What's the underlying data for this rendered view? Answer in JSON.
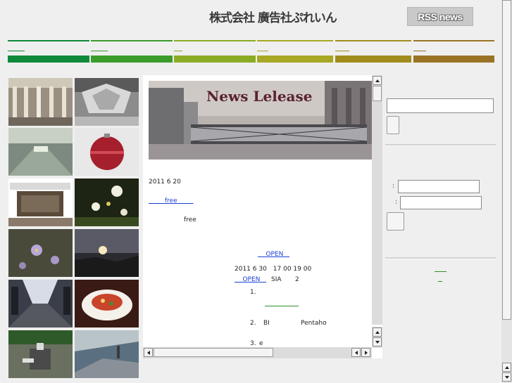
{
  "header": {
    "logo_text": "株式会社 廣告社ぷれいん",
    "rss_label": "RSS news"
  },
  "nav": {
    "colors": [
      "#0f8a3a",
      "#3a9c2a",
      "#8cab25",
      "#a8a824",
      "#a08c1c",
      "#9a7425"
    ]
  },
  "gallery": {
    "photos": [
      "hall-columns-photo",
      "chandelier-photo",
      "corridor-photo",
      "red-ornament-photo",
      "signboard-photo",
      "white-flowers-photo",
      "purple-flowers-photo",
      "sunset-photo",
      "train-corridor-photo",
      "pasta-dish-photo",
      "rooftop-photo",
      "harbor-view-photo"
    ]
  },
  "news": {
    "banner_title": "News Lelease",
    "date": "2011 6 20",
    "link_free": "free",
    "text_free": "free",
    "link_open": "OPEN",
    "datetime": "2011 6 30　17 00 19 00",
    "open2": "OPEN",
    "sia": "SIA",
    "sia_num": "2",
    "item1": "1.",
    "item2": "2.",
    "item2_bi": "BI",
    "item2_pentaho": "Pentaho",
    "item3": "3.",
    "item3_e": "e"
  },
  "sidebar": {
    "colon1": ":",
    "colon2": ":"
  }
}
